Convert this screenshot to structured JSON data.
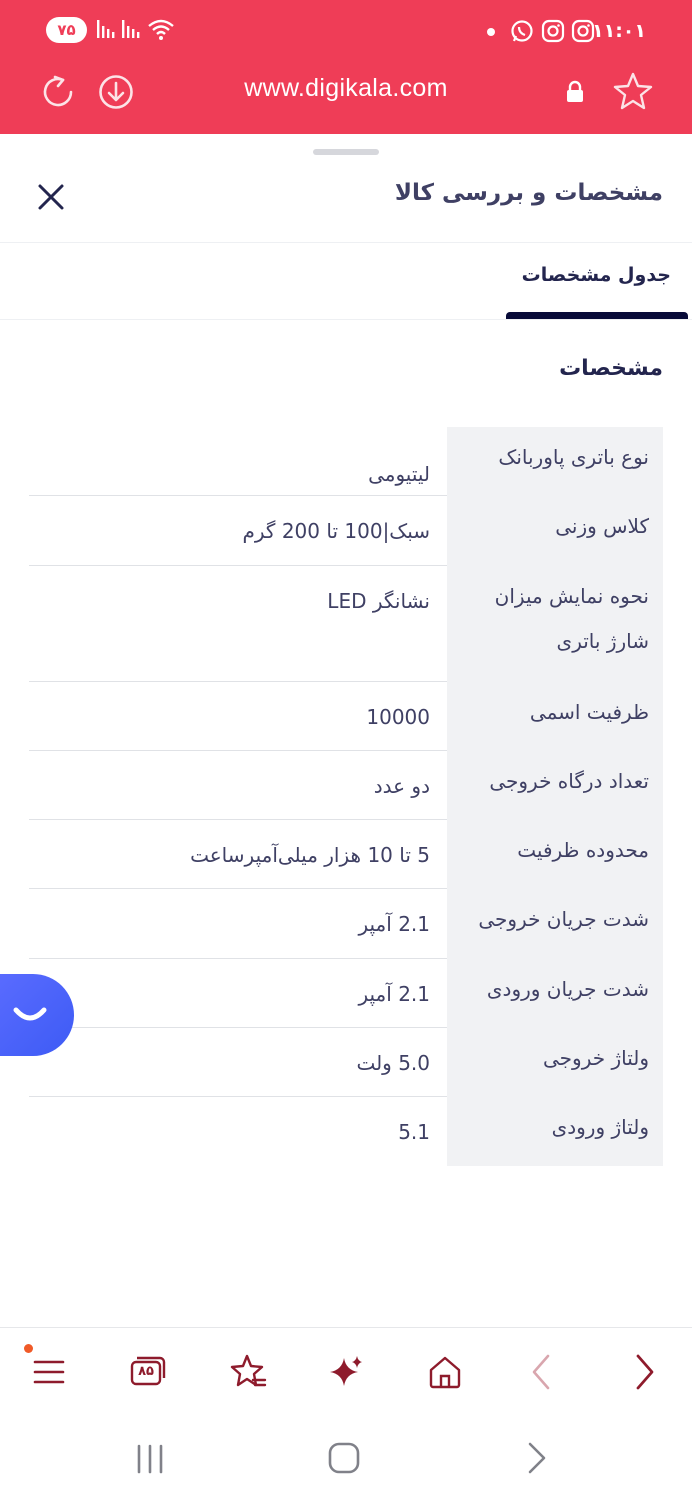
{
  "status_bar": {
    "battery_level": "۷۵",
    "time": "۱۱:۰۱"
  },
  "browser": {
    "url": "www.digikala.com",
    "accent_color": "#ef3d57"
  },
  "sheet": {
    "title": "مشخصات و بررسی کالا",
    "tab": "جدول مشخصات",
    "section_title": "مشخصات"
  },
  "specs": [
    {
      "label": "نوع باتری پاوربانک",
      "value": "لیتیومی"
    },
    {
      "label": "کلاس وزنی",
      "value": "سبک|100 تا 200 گرم"
    },
    {
      "label": "نحوه نمایش میزان شارژ باتری",
      "value": "نشانگر LED"
    },
    {
      "label": "ظرفیت اسمی",
      "value": "10000"
    },
    {
      "label": "تعداد درگاه خروجی",
      "value": "دو عدد"
    },
    {
      "label": "محدوده ظرفیت",
      "value": "5 تا 10 هزار میلی‌آمپرساعت"
    },
    {
      "label": "شدت جریان خروجی",
      "value": "2.1 آمپر"
    },
    {
      "label": "شدت جریان ورودی",
      "value": "2.1 آمپر"
    },
    {
      "label": "ولتاژ خروجی",
      "value": "5.0 ولت"
    },
    {
      "label": "ولتاژ ورودی",
      "value": "5.1"
    }
  ],
  "toolbar": {
    "tabs_count": "۸۵",
    "icon_color": "#8e1b2c"
  }
}
